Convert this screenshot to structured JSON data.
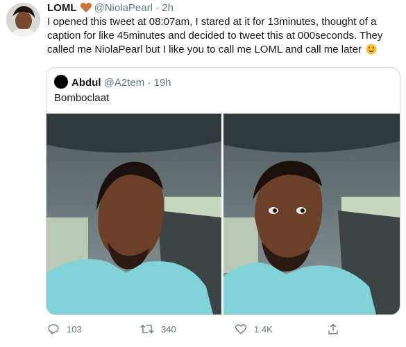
{
  "tweet": {
    "display_name": "LOML",
    "handle": "@NiolaPearl",
    "separator": "·",
    "time": "2h",
    "text": "I opened this tweet at 08:07am, I stared at it for 13minutes, thought of a caption for like 45minutes and decided to tweet this at 000seconds. They called me NiolaPearl but I like you to call me LOML and call me later",
    "emoji": "winking-face-icon"
  },
  "quoted": {
    "display_name": "Abdul",
    "handle": "@A2tem",
    "separator": "·",
    "time": "19h",
    "text": "Bomboclaat"
  },
  "actions": {
    "reply_count": "103",
    "retweet_count": "340",
    "like_count": "1.4K"
  },
  "colors": {
    "text": "#14171a",
    "muted": "#657786",
    "border": "#ccd6dd",
    "heart": "#c8763a",
    "shirt": "#7fd3d9"
  }
}
